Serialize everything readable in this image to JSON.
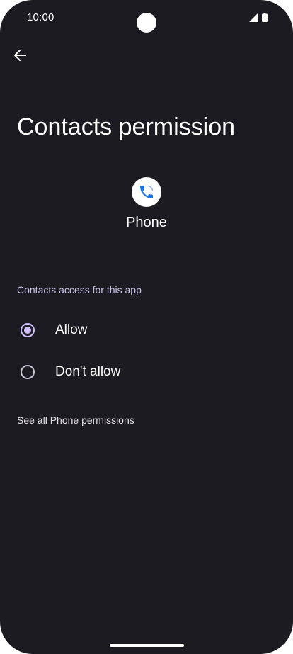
{
  "status_bar": {
    "time": "10:00"
  },
  "header": {
    "back_icon": "arrow-back-icon",
    "title": "Contacts permission"
  },
  "app": {
    "icon": "phone-icon",
    "name": "Phone"
  },
  "permission": {
    "section_label": "Contacts access for this app",
    "options": [
      {
        "label": "Allow",
        "selected": true
      },
      {
        "label": "Don't allow",
        "selected": false
      }
    ]
  },
  "footer": {
    "see_all_label": "See all Phone permissions"
  },
  "colors": {
    "background": "#1c1b21",
    "accent": "#cdbdff",
    "phone_blue": "#1a73e8"
  }
}
